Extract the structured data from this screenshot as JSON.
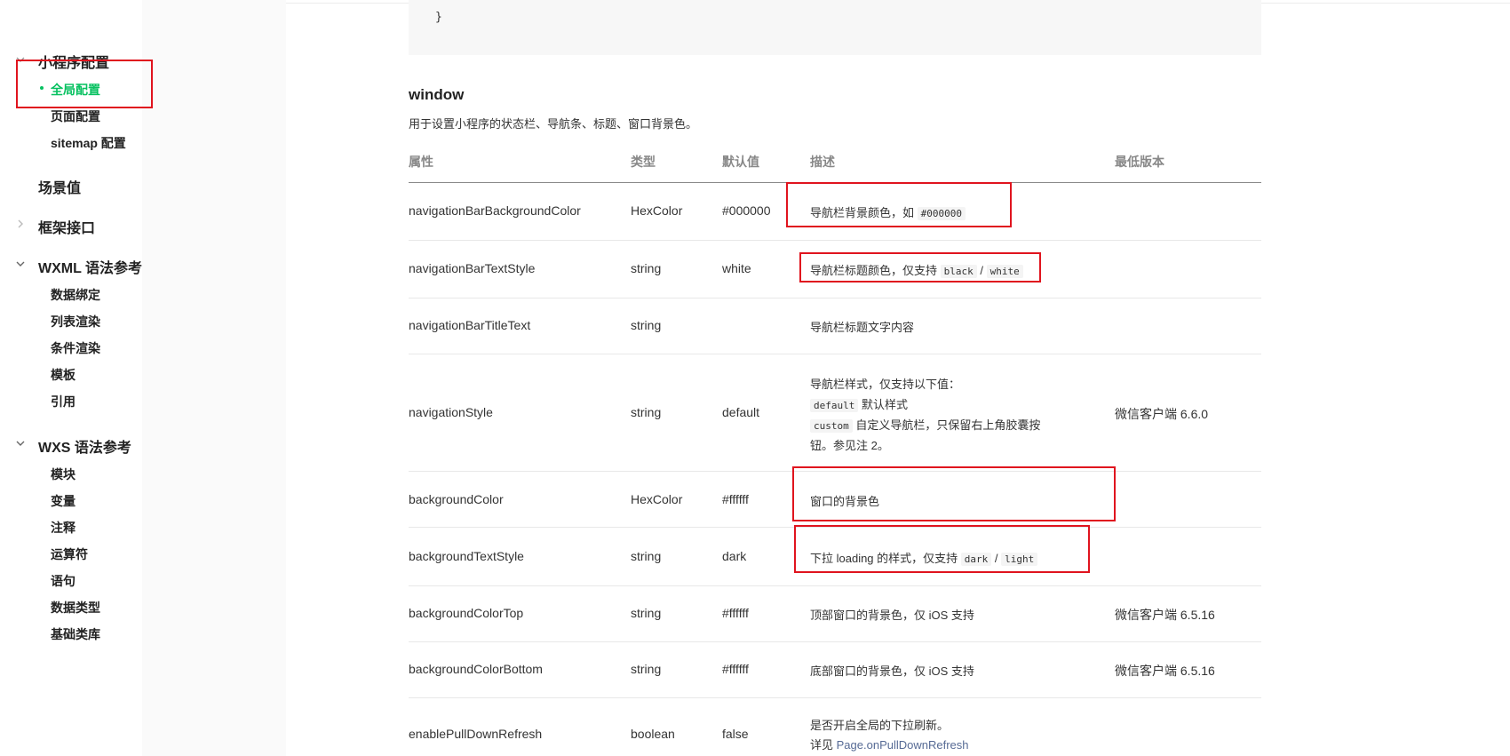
{
  "sidebar": {
    "groups": [
      {
        "label": "小程序配置",
        "expanded": true,
        "items": [
          {
            "label": "全局配置",
            "active": true
          },
          {
            "label": "页面配置"
          },
          {
            "label": "sitemap 配置"
          }
        ]
      },
      {
        "label": "场景值"
      },
      {
        "label": "框架接口",
        "expanded": false
      },
      {
        "label": "WXML 语法参考",
        "expanded": true,
        "items": [
          {
            "label": "数据绑定"
          },
          {
            "label": "列表渲染"
          },
          {
            "label": "条件渲染"
          },
          {
            "label": "模板"
          },
          {
            "label": "引用"
          }
        ]
      },
      {
        "label": "WXS 语法参考",
        "expanded": true,
        "items": [
          {
            "label": "模块"
          },
          {
            "label": "变量"
          },
          {
            "label": "注释"
          },
          {
            "label": "运算符"
          },
          {
            "label": "语句"
          },
          {
            "label": "数据类型"
          },
          {
            "label": "基础类库"
          }
        ]
      }
    ]
  },
  "code": {
    "closing_brace": "}"
  },
  "section": {
    "title": "window",
    "description": "用于设置小程序的状态栏、导航条、标题、窗口背景色。"
  },
  "table": {
    "headers": [
      "属性",
      "类型",
      "默认值",
      "描述",
      "最低版本"
    ],
    "rows": [
      {
        "prop": "navigationBarBackgroundColor",
        "type": "HexColor",
        "default": "#000000",
        "desc_text": "导航栏背景颜色，如",
        "desc_code": "#000000",
        "version": ""
      },
      {
        "prop": "navigationBarTextStyle",
        "type": "string",
        "default": "white",
        "desc_text": "导航栏标题颜色，仅支持",
        "desc_code1": "black",
        "desc_sep": "/",
        "desc_code2": "white",
        "version": ""
      },
      {
        "prop": "navigationBarTitleText",
        "type": "string",
        "default": "",
        "desc_text": "导航栏标题文字内容",
        "version": ""
      },
      {
        "prop": "navigationStyle",
        "type": "string",
        "default": "default",
        "desc_line1": "导航栏样式，仅支持以下值：",
        "desc_code1": "default",
        "desc_line2": "默认样式",
        "desc_code2": "custom",
        "desc_line3": "自定义导航栏，只保留右上角胶囊按",
        "desc_line4": "钮。参见注 2。",
        "version": "微信客户端 6.6.0"
      },
      {
        "prop": "backgroundColor",
        "type": "HexColor",
        "default": "#ffffff",
        "desc_text": "窗口的背景色",
        "version": ""
      },
      {
        "prop": "backgroundTextStyle",
        "type": "string",
        "default": "dark",
        "desc_text": "下拉 loading 的样式，仅支持",
        "desc_code1": "dark",
        "desc_sep": "/",
        "desc_code2": "light",
        "version": ""
      },
      {
        "prop": "backgroundColorTop",
        "type": "string",
        "default": "#ffffff",
        "desc_text": "顶部窗口的背景色，仅 iOS 支持",
        "version": "微信客户端 6.5.16"
      },
      {
        "prop": "backgroundColorBottom",
        "type": "string",
        "default": "#ffffff",
        "desc_text": "底部窗口的背景色，仅 iOS 支持",
        "version": "微信客户端 6.5.16"
      },
      {
        "prop": "enablePullDownRefresh",
        "type": "boolean",
        "default": "false",
        "desc_line1": "是否开启全局的下拉刷新。",
        "desc_prefix": "详见",
        "desc_link": "Page.onPullDownRefresh",
        "version": ""
      }
    ]
  },
  "colors": {
    "accent": "#07c160",
    "highlight": "#e0141e",
    "link": "#576b95"
  }
}
